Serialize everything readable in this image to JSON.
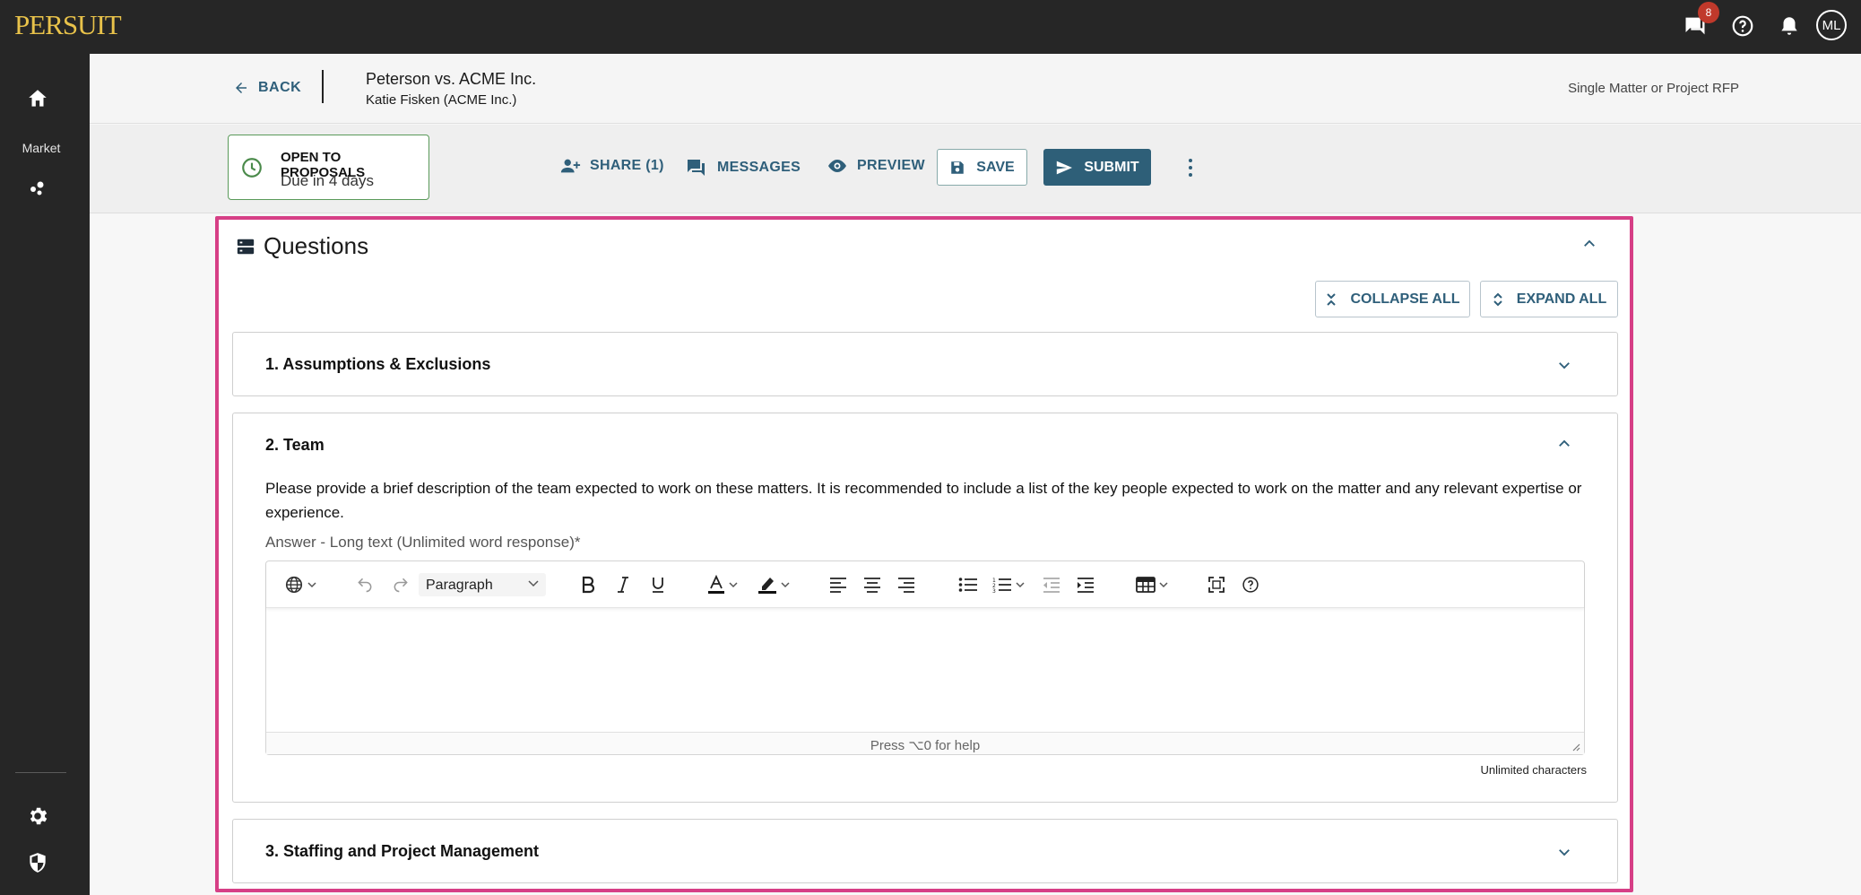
{
  "app": {
    "logo_text": "PERSUIT",
    "messages_badge": "8",
    "avatar_initials": "ML",
    "colors": {
      "topbar": "#262626",
      "accent": "#2f5f7a",
      "logo": "#e8c24a",
      "highlight_border": "#d63f86",
      "status_border": "#5a9a5a"
    }
  },
  "sidebar": {
    "items": [
      {
        "icon": "home-icon"
      },
      {
        "label": "Market",
        "icon": "market-icon"
      },
      {
        "icon": "gear-icon"
      },
      {
        "icon": "shield-icon"
      }
    ]
  },
  "header": {
    "back_label": "BACK",
    "matter_title": "Peterson vs. ACME Inc.",
    "matter_sub": "Katie Fisken (ACME Inc.)",
    "rfp_type": "Single Matter or Project RFP"
  },
  "actionbar": {
    "status_title": "OPEN TO PROPOSALS",
    "status_due": "Due in 4 days",
    "share_label": "SHARE (1)",
    "messages_label": "MESSAGES",
    "preview_label": "PREVIEW",
    "save_label": "SAVE",
    "submit_label": "SUBMIT"
  },
  "questions": {
    "title": "Questions",
    "collapse_all": "COLLAPSE ALL",
    "expand_all": "EXPAND ALL",
    "sections": [
      {
        "title": "1. Assumptions & Exclusions",
        "expanded": false
      },
      {
        "title": "2. Team",
        "expanded": true,
        "description": "Please provide a brief description of the team expected to work on these matters. It is recommended to include a list of the key people expected to work on the matter and any relevant expertise or experience.",
        "answer_label": "Answer - Long text (Unlimited word response)*",
        "editor": {
          "block_format": "Paragraph",
          "help_text": "Press ⌥0 for help",
          "value": ""
        },
        "char_limit": "Unlimited characters"
      },
      {
        "title": "3. Staffing and Project Management",
        "expanded": false
      }
    ]
  }
}
